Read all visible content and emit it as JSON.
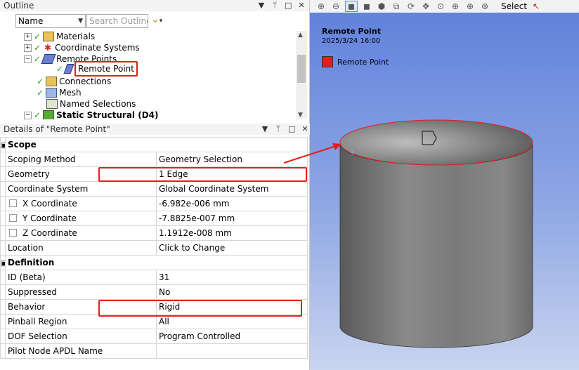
{
  "outline": {
    "title": "Outline",
    "name_select": "Name",
    "search_placeholder": "Search Outline",
    "tree": [
      {
        "label": "Materials"
      },
      {
        "label": "Coordinate Systems"
      },
      {
        "label": "Remote Points"
      },
      {
        "label": "Remote Point"
      },
      {
        "label": "Connections"
      },
      {
        "label": "Mesh"
      },
      {
        "label": "Named Selections"
      },
      {
        "label": "Static Structural (D4)"
      }
    ]
  },
  "details": {
    "title": "Details of \"Remote Point\"",
    "scope_group": "Scope",
    "definition_group": "Definition",
    "rows": [
      {
        "label": "Scoping Method",
        "value": "Geometry Selection"
      },
      {
        "label": "Geometry",
        "value": "1 Edge"
      },
      {
        "label": "Coordinate System",
        "value": "Global Coordinate System"
      },
      {
        "label": "X Coordinate",
        "value": "-6.982e-006 mm"
      },
      {
        "label": "Y Coordinate",
        "value": "-7.8825e-007 mm"
      },
      {
        "label": "Z Coordinate",
        "value": "1.1912e-008 mm"
      },
      {
        "label": "Location",
        "value": "Click to Change"
      },
      {
        "label": "ID (Beta)",
        "value": "31"
      },
      {
        "label": "Suppressed",
        "value": "No"
      },
      {
        "label": "Behavior",
        "value": "Rigid"
      },
      {
        "label": "Pinball Region",
        "value": "All"
      },
      {
        "label": "DOF Selection",
        "value": "Program Controlled"
      },
      {
        "label": "Pilot Node APDL Name",
        "value": ""
      }
    ]
  },
  "viewport": {
    "toolbar_select": "Select",
    "legend_title": "Remote Point",
    "legend_date": "2025/3/24 16:00",
    "legend_item": "Remote Point",
    "legend_color": "#e02020"
  }
}
